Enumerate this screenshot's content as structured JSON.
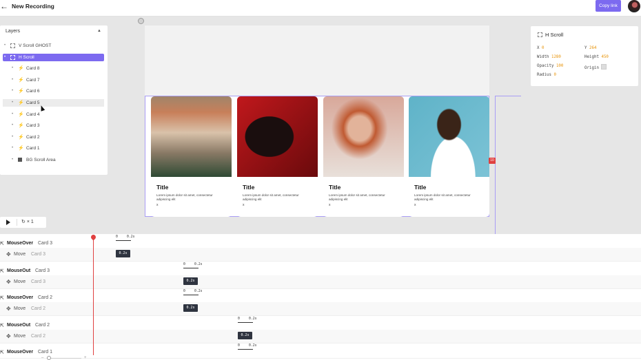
{
  "header": {
    "title": "New Recording",
    "copy_label": "Copy link"
  },
  "layers": {
    "header": "Layers",
    "items": [
      {
        "label": "V Scroll GHOST",
        "indent": 0,
        "icon": "ghost-frame-icon",
        "state": "normal"
      },
      {
        "label": "H Scroll",
        "indent": 0,
        "icon": "ghost-frame-icon",
        "state": "selected"
      },
      {
        "label": "Card 8",
        "indent": 1,
        "icon": "lightning-icon",
        "state": "normal"
      },
      {
        "label": "Card 7",
        "indent": 1,
        "icon": "lightning-icon",
        "state": "normal"
      },
      {
        "label": "Card 6",
        "indent": 1,
        "icon": "lightning-icon",
        "state": "normal"
      },
      {
        "label": "Card 5",
        "indent": 1,
        "icon": "lightning-icon",
        "state": "hover"
      },
      {
        "label": "Card 4",
        "indent": 1,
        "icon": "lightning-icon",
        "state": "normal"
      },
      {
        "label": "Card 3",
        "indent": 1,
        "icon": "lightning-icon",
        "state": "normal"
      },
      {
        "label": "Card 2",
        "indent": 1,
        "icon": "lightning-icon",
        "state": "normal"
      },
      {
        "label": "Card 1",
        "indent": 1,
        "icon": "lightning-icon",
        "state": "normal"
      },
      {
        "label": "BG Scroll Area",
        "indent": 1,
        "icon": "square-fill-icon",
        "state": "normal"
      }
    ]
  },
  "cards": [
    {
      "title": "Title",
      "body": "Lorem ipsum dolor sit amet, consectetur adipiscing elit",
      "close": "x"
    },
    {
      "title": "Title",
      "body": "Lorem ipsum dolor sit amet, consectetur adipiscing elit",
      "close": "x"
    },
    {
      "title": "Title",
      "body": "Lorem ipsum dolor sit amet, consectetur adipiscing elit",
      "close": "x"
    },
    {
      "title": "Title",
      "body": "Lorem ipsum dolor sit amet, consectetur adipiscing elit",
      "close": "x"
    }
  ],
  "canvas": {
    "badge": "10"
  },
  "properties": {
    "title": "H Scroll",
    "x_label": "X",
    "x": "0",
    "y_label": "Y",
    "y": "264",
    "width_label": "Width",
    "width": "1280",
    "height_label": "Height",
    "height": "450",
    "opacity_label": "Opacity",
    "opacity": "100",
    "origin_label": "Origin",
    "radius_label": "Radius",
    "radius": "0"
  },
  "playback": {
    "speed": "× 1"
  },
  "timeline": {
    "rows": [
      {
        "event": "MouseOver",
        "target": "Card 3",
        "action": "Move",
        "action_target": "Card 3",
        "start": "0",
        "duration": "0.2s"
      },
      {
        "event": "MouseOut",
        "target": "Card 3",
        "action": "Move",
        "action_target": "Card 3",
        "start": "0",
        "duration": "0.2s"
      },
      {
        "event": "MouseOver",
        "target": "Card 2",
        "action": "Move",
        "action_target": "Card 2",
        "start": "0",
        "duration": "0.2s"
      },
      {
        "event": "MouseOut",
        "target": "Card 2",
        "action": "Move",
        "action_target": "Card 2",
        "start": "0",
        "duration": "0.2s"
      },
      {
        "event": "MouseOver",
        "target": "Card 1",
        "action": "",
        "action_target": "",
        "start": "0",
        "duration": "0.2s"
      }
    ]
  },
  "colors": {
    "accent": "#7c6af0",
    "playhead": "#e04040",
    "value": "#e8940a"
  }
}
